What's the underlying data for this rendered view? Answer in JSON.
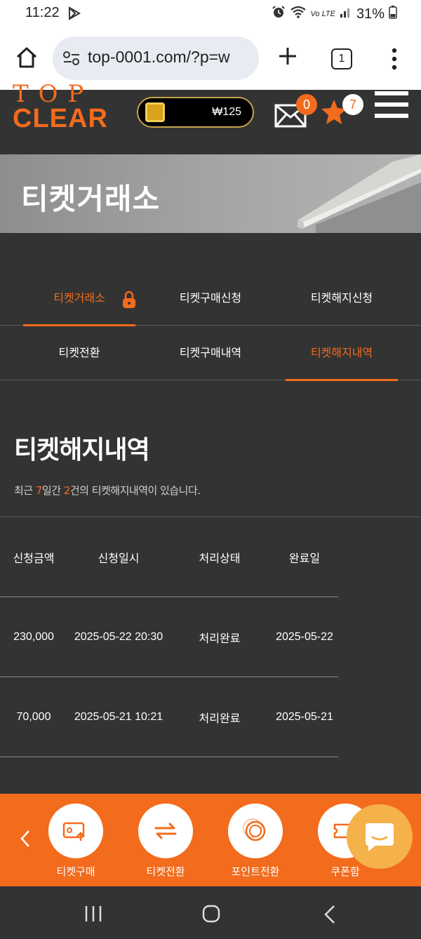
{
  "status_bar": {
    "time": "11:22",
    "lte": "Vo LTE",
    "battery": "31%"
  },
  "browser": {
    "url": "top-0001.com/?p=w",
    "tab_count": "1"
  },
  "header": {
    "logo_top": "TOP",
    "logo": "CLEAR",
    "wallet_amount": "₩125",
    "mail_count": "0",
    "favorites_count": "7"
  },
  "banner": {
    "title": "티켓거래소"
  },
  "tabs": [
    {
      "label": "티켓거래소",
      "active": true
    },
    {
      "label": "티켓구매신청",
      "active": false
    },
    {
      "label": "티켓해지신청",
      "active": false
    },
    {
      "label": "티켓전환",
      "active": false
    },
    {
      "label": "티켓구매내역",
      "active": false
    },
    {
      "label": "티켓해지내역",
      "active": true
    }
  ],
  "section": {
    "title": "티켓해지내역",
    "subtitle_pre": "최근 ",
    "days": "7",
    "subtitle_mid": "일간 ",
    "count": "2",
    "subtitle_post": "건의 티켓해지내역이 있습니다."
  },
  "table": {
    "headers": [
      "신청금액",
      "신청일시",
      "처리상태",
      "완료일"
    ],
    "rows": [
      [
        "230,000",
        "2025-05-22 20:30",
        "처리완료",
        "2025-05-22"
      ],
      [
        "70,000",
        "2025-05-21 10:21",
        "처리완료",
        "2025-05-21"
      ]
    ]
  },
  "quick_nav": [
    {
      "label": "티켓구매",
      "icon": "ticket-buy-icon"
    },
    {
      "label": "티켓전환",
      "icon": "exchange-icon"
    },
    {
      "label": "포인트전환",
      "icon": "coins-icon"
    },
    {
      "label": "쿠폰함",
      "icon": "coupon-icon"
    }
  ],
  "colors": {
    "accent": "#f36b1d",
    "background": "#333333",
    "chat": "#f5b14a"
  }
}
